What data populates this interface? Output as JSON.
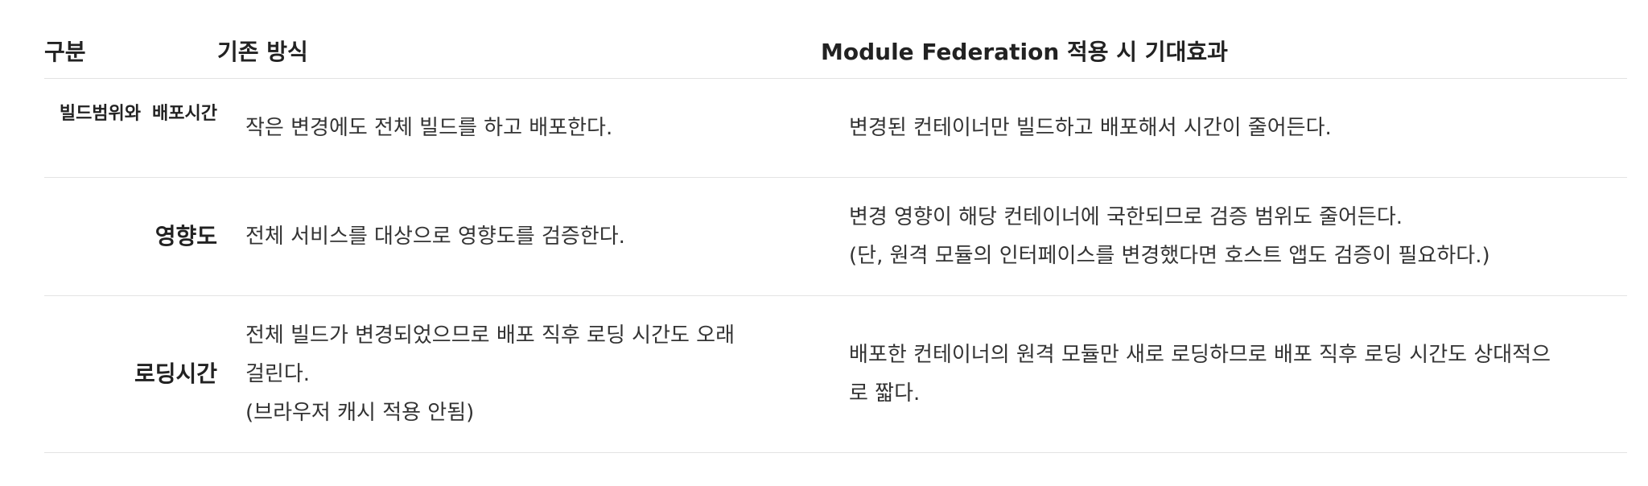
{
  "table": {
    "headers": {
      "category": "구분",
      "existing": "기존 방식",
      "federation": "Module Federation 적용 시 기대효과"
    },
    "rows": [
      {
        "category_part1": "빌드범위와",
        "category_part2": "배포시간",
        "existing": [
          "작은 변경에도 전체 빌드를 하고 배포한다."
        ],
        "federation": [
          "변경된 컨테이너만 빌드하고 배포해서 시간이 줄어든다."
        ]
      },
      {
        "category": "영향도",
        "existing": [
          "전체 서비스를 대상으로 영향도를 검증한다."
        ],
        "federation": [
          "변경 영향이 해당 컨테이너에 국한되므로 검증 범위도 줄어든다.",
          "(단, 원격 모듈의 인터페이스를 변경했다면 호스트 앱도 검증이 필요하다.)"
        ]
      },
      {
        "category": "로딩시간",
        "existing": [
          "전체 빌드가 변경되었으므로 배포 직후 로딩 시간도 오래",
          "걸린다.",
          "(브라우저 캐시 적용 안됨)"
        ],
        "federation": [
          "배포한 컨테이너의 원격 모듈만 새로 로딩하므로 배포 직후 로딩 시간도 상대적으",
          "로 짧다."
        ]
      }
    ]
  }
}
